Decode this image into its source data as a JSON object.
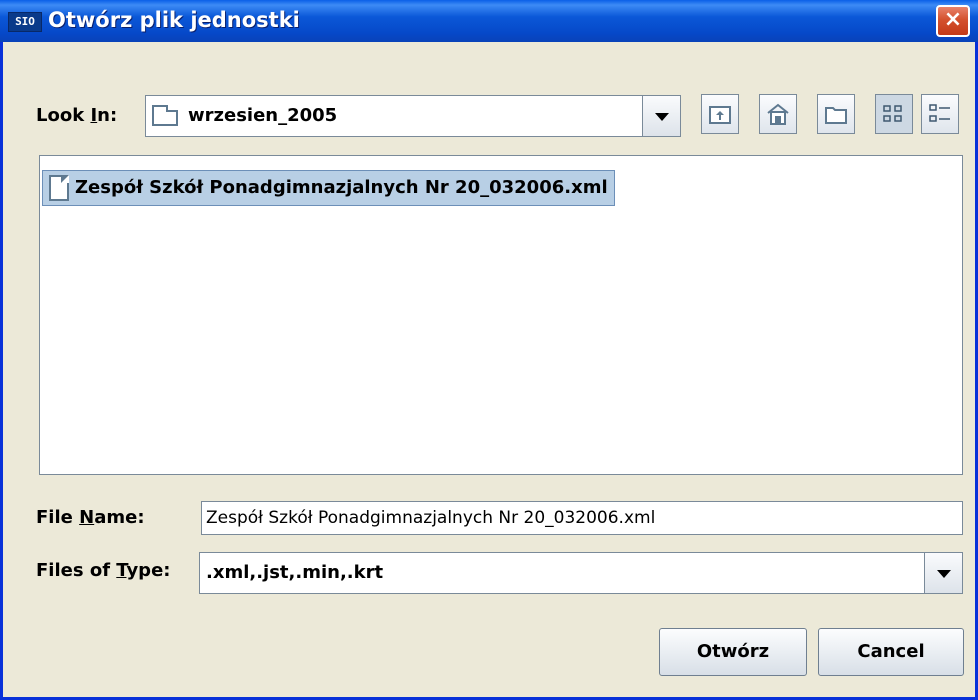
{
  "window": {
    "app_icon": "SIO",
    "title": "Otwórz plik jednostki",
    "close": "×"
  },
  "look_in": {
    "label_pre": "Look ",
    "label_mnemonic": "I",
    "label_post": "n:",
    "value": "wrzesien_2005"
  },
  "toolbar": {
    "icons": [
      "up-folder-icon",
      "home-icon",
      "new-folder-icon",
      "list-view-icon",
      "details-view-icon"
    ],
    "selected_view": "list"
  },
  "files": [
    {
      "name": "Zespół Szkół Ponadgimnazjalnych Nr 20_032006.xml",
      "selected": true
    }
  ],
  "file_name": {
    "label_pre": "File ",
    "label_mnemonic": "N",
    "label_post": "ame:",
    "value": "Zespół Szkół Ponadgimnazjalnych Nr 20_032006.xml"
  },
  "files_of_type": {
    "label_pre": "Files of ",
    "label_mnemonic": "T",
    "label_post": "ype:",
    "value": ".xml,.jst,.min,.krt"
  },
  "buttons": {
    "open": "Otwórz",
    "cancel": "Cancel"
  }
}
